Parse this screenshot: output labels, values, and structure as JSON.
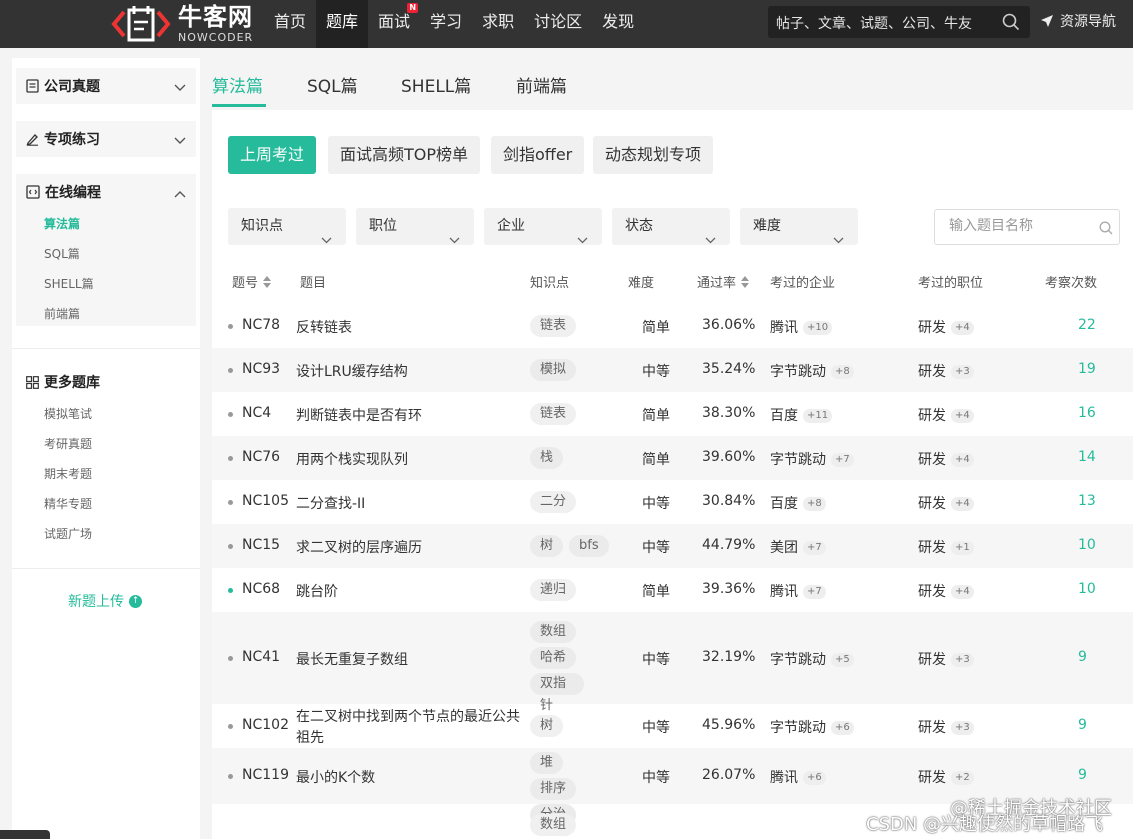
{
  "brand": {
    "name_cn": "牛客网",
    "name_en": "NOWCODER"
  },
  "nav": {
    "items": [
      {
        "label": "首页"
      },
      {
        "label": "题库",
        "active": true
      },
      {
        "label": "面试",
        "badge": "N"
      },
      {
        "label": "学习"
      },
      {
        "label": "求职"
      },
      {
        "label": "讨论区"
      },
      {
        "label": "发现"
      }
    ],
    "search_placeholder": "帖子、文章、试题、公司、牛友",
    "resource_nav": "资源导航"
  },
  "sidebar": {
    "sections": [
      {
        "label": "公司真题",
        "icon": "doc-icon",
        "expanded": false
      },
      {
        "label": "专项练习",
        "icon": "pen-icon",
        "expanded": false
      },
      {
        "label": "在线编程",
        "icon": "code-icon",
        "expanded": true
      }
    ],
    "online_sub": [
      "算法篇",
      "SQL篇",
      "SHELL篇",
      "前端篇"
    ],
    "more_title": "更多题库",
    "more_items": [
      "模拟笔试",
      "考研真题",
      "期末考题",
      "精华专题",
      "试题广场"
    ],
    "upload": "新题上传"
  },
  "tabs": [
    "算法篇",
    "SQL篇",
    "SHELL篇",
    "前端篇"
  ],
  "chips": [
    "上周考过",
    "面试高频TOP榜单",
    "剑指offer",
    "动态规划专项"
  ],
  "filters": [
    "知识点",
    "职位",
    "企业",
    "状态",
    "难度"
  ],
  "question_search_placeholder": "输入题目名称",
  "table": {
    "headers": [
      "题号",
      "题目",
      "知识点",
      "难度",
      "通过率",
      "考过的企业",
      "考过的职位",
      "考察次数"
    ],
    "rows": [
      {
        "id": "NC78",
        "title": "反转链表",
        "tags": [
          "链表"
        ],
        "difficulty": "简单",
        "rate": "36.06%",
        "company": "腾讯",
        "company_more": "+10",
        "position": "研发",
        "position_more": "+4",
        "count": "22"
      },
      {
        "id": "NC93",
        "title": "设计LRU缓存结构",
        "tags": [
          "模拟"
        ],
        "difficulty": "中等",
        "rate": "35.24%",
        "company": "字节跳动",
        "company_more": "+8",
        "position": "研发",
        "position_more": "+3",
        "count": "19"
      },
      {
        "id": "NC4",
        "title": "判断链表中是否有环",
        "tags": [
          "链表"
        ],
        "difficulty": "简单",
        "rate": "38.30%",
        "company": "百度",
        "company_more": "+11",
        "position": "研发",
        "position_more": "+4",
        "count": "16"
      },
      {
        "id": "NC76",
        "title": "用两个栈实现队列",
        "tags": [
          "栈"
        ],
        "difficulty": "简单",
        "rate": "39.60%",
        "company": "字节跳动",
        "company_more": "+7",
        "position": "研发",
        "position_more": "+4",
        "count": "14"
      },
      {
        "id": "NC105",
        "title": "二分查找-II",
        "tags": [
          "二分"
        ],
        "difficulty": "中等",
        "rate": "30.84%",
        "company": "百度",
        "company_more": "+8",
        "position": "研发",
        "position_more": "+4",
        "count": "13"
      },
      {
        "id": "NC15",
        "title": "求二叉树的层序遍历",
        "tags": [
          "树",
          "bfs"
        ],
        "difficulty": "中等",
        "rate": "44.79%",
        "company": "美团",
        "company_more": "+7",
        "position": "研发",
        "position_more": "+1",
        "count": "10"
      },
      {
        "id": "NC68",
        "title": "跳台阶",
        "tags": [
          "递归"
        ],
        "difficulty": "简单",
        "rate": "39.36%",
        "company": "腾讯",
        "company_more": "+7",
        "position": "研发",
        "position_more": "+4",
        "count": "10"
      },
      {
        "id": "NC41",
        "title": "最长无重复子数组",
        "tags": [
          "数组",
          "哈希",
          "双指针"
        ],
        "difficulty": "中等",
        "rate": "32.19%",
        "company": "字节跳动",
        "company_more": "+5",
        "position": "研发",
        "position_more": "+3",
        "count": "9"
      },
      {
        "id": "NC102",
        "title": "在二叉树中找到两个节点的最近公共祖先",
        "title_l1": "在二叉树中找到两个节点的最近公共",
        "title_l2": "祖先",
        "tags": [
          "树"
        ],
        "difficulty": "中等",
        "rate": "45.96%",
        "company": "字节跳动",
        "company_more": "+6",
        "position": "研发",
        "position_more": "+3",
        "count": "9"
      },
      {
        "id": "NC119",
        "title": "最小的K个数",
        "tags": [
          "堆",
          "排序",
          "分治"
        ],
        "difficulty": "中等",
        "rate": "26.07%",
        "company": "腾讯",
        "company_more": "+6",
        "position": "研发",
        "position_more": "+2",
        "count": "9"
      },
      {
        "id": "",
        "title": "",
        "tags": [
          "数组"
        ],
        "difficulty": "",
        "rate": "",
        "company": "",
        "company_more": "",
        "position": "",
        "position_more": "",
        "count": ""
      }
    ]
  },
  "watermark": {
    "line1": "@稀土掘金技术社区",
    "line2": "CSDN @兴趣使然的草帽路飞"
  }
}
